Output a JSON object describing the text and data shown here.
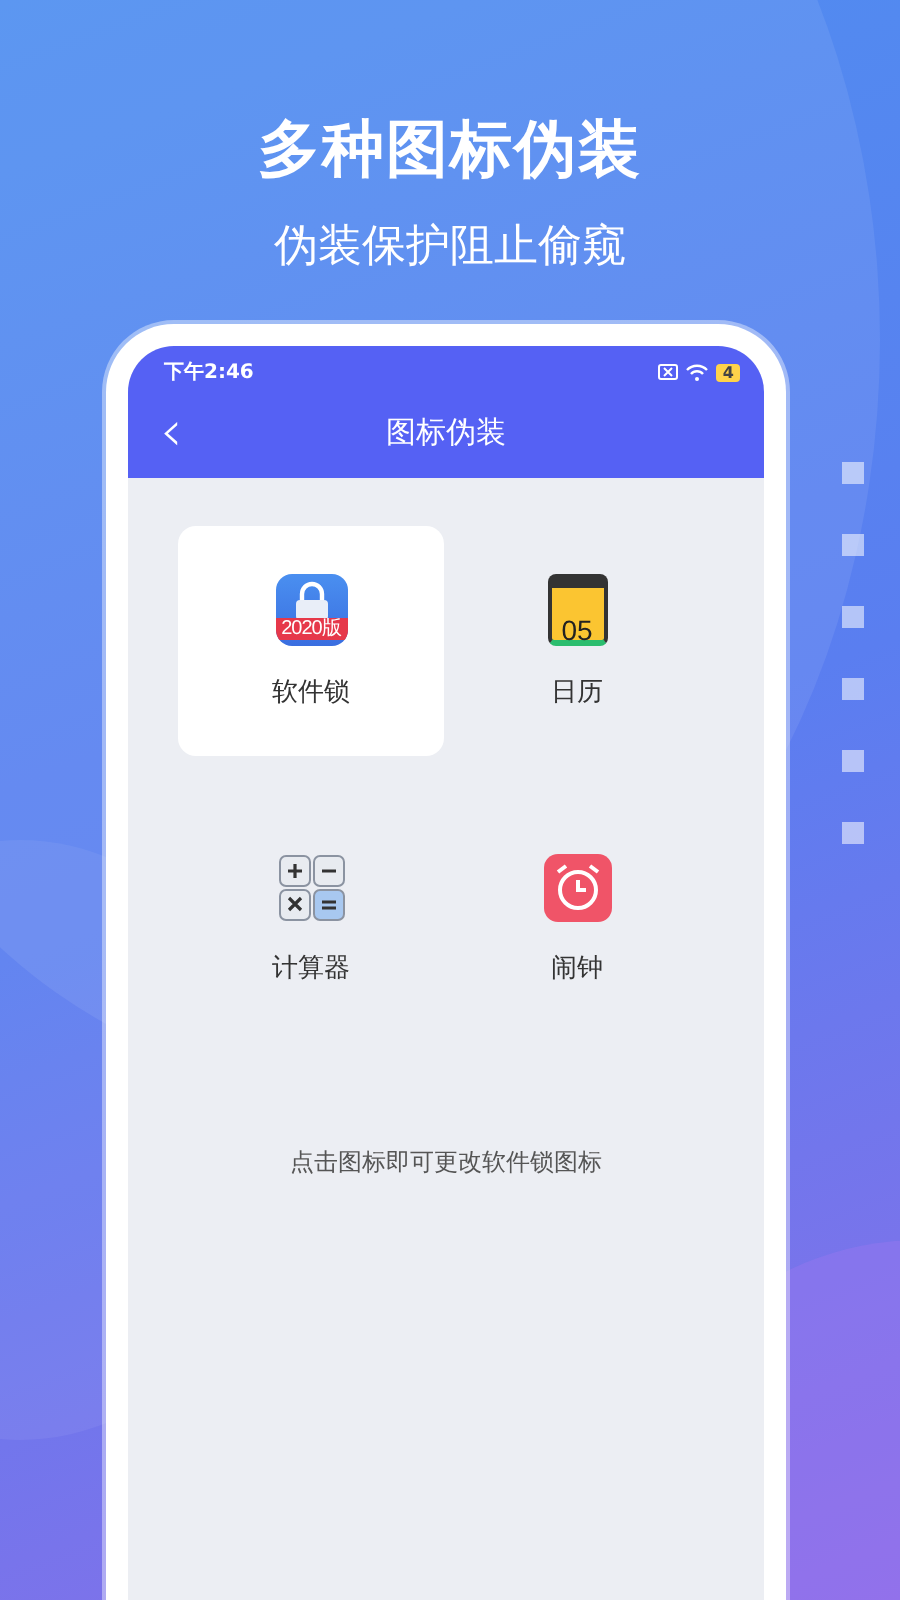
{
  "headline": "多种图标伪装",
  "subheadline": "伪装保护阻止偷窥",
  "status_bar": {
    "time": "下午2:46",
    "battery": "4"
  },
  "nav": {
    "back": "‹",
    "title": "图标伪装"
  },
  "icons": [
    {
      "kind": "lock",
      "label": "软件锁",
      "badge": "2020版",
      "selected": true
    },
    {
      "kind": "calendar",
      "label": "日历",
      "date": "05",
      "selected": false
    },
    {
      "kind": "calculator",
      "label": "计算器",
      "selected": false
    },
    {
      "kind": "alarm",
      "label": "闹钟",
      "selected": false
    }
  ],
  "hint": "点击图标即可更改软件锁图标"
}
